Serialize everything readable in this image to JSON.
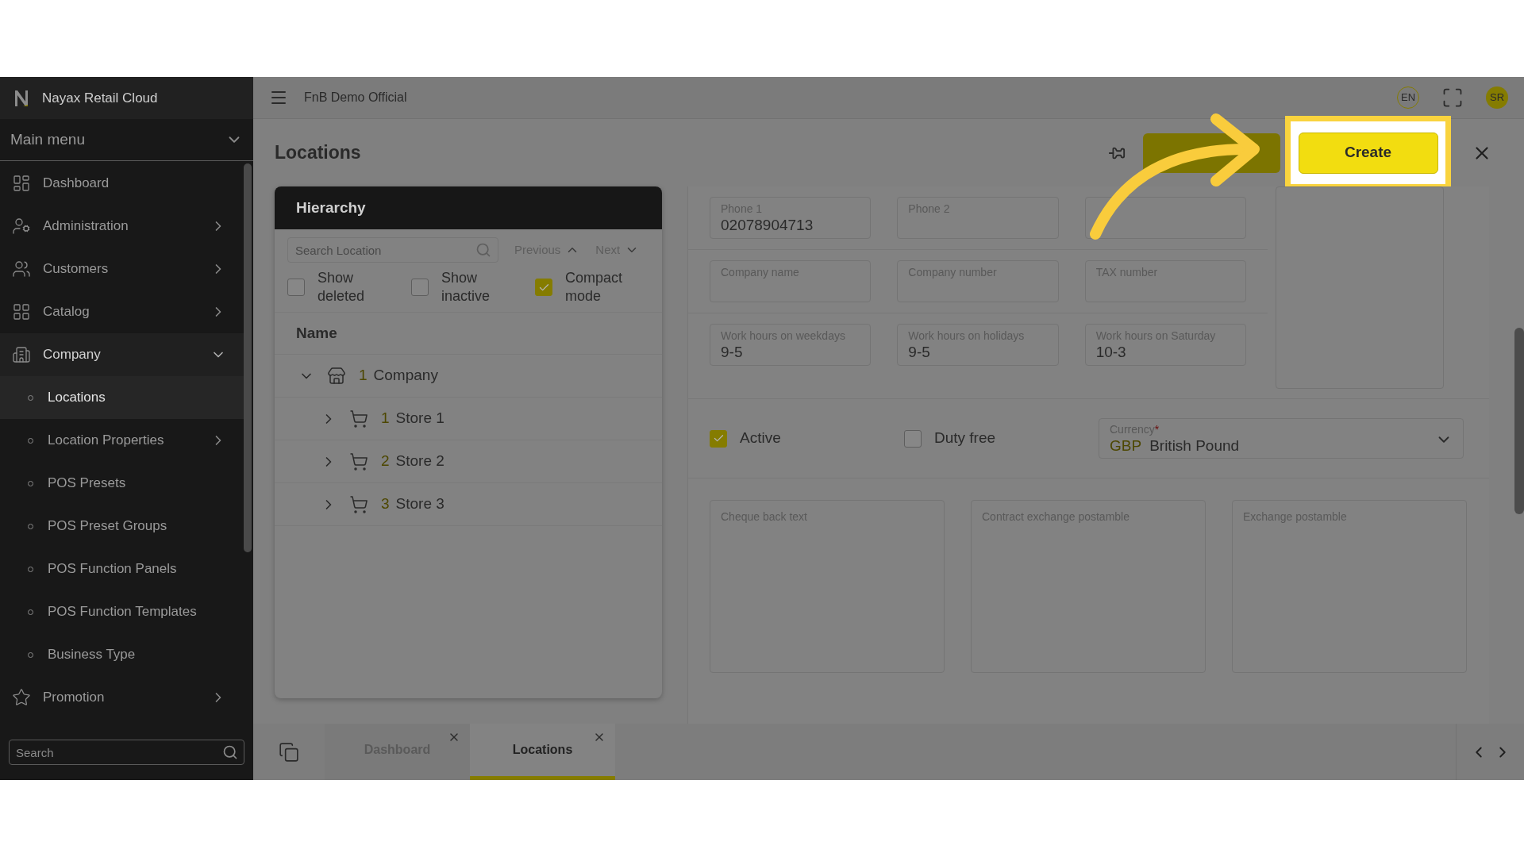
{
  "app": {
    "brand": "Nayax Retail Cloud",
    "company": "FnB Demo Official",
    "language": "EN",
    "avatar": "SR"
  },
  "sidebar": {
    "menu_title": "Main menu",
    "search_placeholder": "Search",
    "items": [
      {
        "label": "Dashboard",
        "has_submenu": false,
        "expanded": false,
        "selected": false
      },
      {
        "label": "Administration",
        "has_submenu": true,
        "expanded": false,
        "selected": false
      },
      {
        "label": "Customers",
        "has_submenu": true,
        "expanded": false,
        "selected": false
      },
      {
        "label": "Catalog",
        "has_submenu": true,
        "expanded": false,
        "selected": false
      },
      {
        "label": "Company",
        "has_submenu": true,
        "expanded": true,
        "selected": false,
        "children": [
          {
            "label": "Locations",
            "has_submenu": false,
            "selected": true
          },
          {
            "label": "Location Properties",
            "has_submenu": true,
            "selected": false
          },
          {
            "label": "POS Presets",
            "has_submenu": false,
            "selected": false
          },
          {
            "label": "POS Preset Groups",
            "has_submenu": false,
            "selected": false
          },
          {
            "label": "POS Function Panels",
            "has_submenu": false,
            "selected": false
          },
          {
            "label": "POS Function Templates",
            "has_submenu": false,
            "selected": false
          },
          {
            "label": "Business Type",
            "has_submenu": false,
            "selected": false
          }
        ]
      },
      {
        "label": "Promotion",
        "has_submenu": true,
        "expanded": false,
        "selected": false
      }
    ]
  },
  "page": {
    "title": "Locations",
    "create_button": "Create"
  },
  "hierarchy": {
    "title": "Hierarchy",
    "search_placeholder": "Search Location",
    "previous": "Previous",
    "next": "Next",
    "filters": [
      {
        "label": "Show deleted",
        "checked": false
      },
      {
        "label": "Show inactive",
        "checked": false
      },
      {
        "label": "Compact mode",
        "checked": true
      }
    ],
    "column": "Name",
    "tree": [
      {
        "kind": "company",
        "number": "1",
        "name": "Company",
        "expanded": true,
        "children": [
          {
            "kind": "store",
            "number": "1",
            "name": "Store 1",
            "expanded": false
          },
          {
            "kind": "store",
            "number": "2",
            "name": "Store 2",
            "expanded": false
          },
          {
            "kind": "store",
            "number": "3",
            "name": "Store 3",
            "expanded": false
          }
        ]
      }
    ]
  },
  "form": {
    "field_rows": [
      [
        {
          "kind": "labelled",
          "label": "Phone 1",
          "value": "02078904713"
        },
        {
          "kind": "labelled",
          "label": "Phone 2"
        },
        {
          "kind": "blank"
        }
      ],
      [
        {
          "kind": "labelled",
          "label": "Company name"
        },
        {
          "kind": "labelled",
          "label": "Company number"
        },
        {
          "kind": "labelled",
          "label": "TAX number"
        }
      ],
      [
        {
          "kind": "labelled",
          "label": "Work hours on weekdays",
          "value": "9-5"
        },
        {
          "kind": "labelled",
          "label": "Work hours on holidays",
          "value": "9-5"
        },
        {
          "kind": "labelled",
          "label": "Work hours on Saturday",
          "value": "10-3"
        }
      ]
    ],
    "checkboxes": [
      {
        "label": "Active",
        "checked": true
      },
      {
        "label": "Duty free",
        "checked": false
      }
    ],
    "currency": {
      "label": "Currency",
      "required_mark": "*",
      "code": "GBP",
      "value": "British Pound"
    },
    "text_areas": [
      {
        "label": "Cheque back text"
      },
      {
        "label": "Contract exchange postamble"
      },
      {
        "label": "Exchange postamble"
      }
    ]
  },
  "tabs": [
    {
      "label": "Dashboard",
      "selected": false
    },
    {
      "label": "Locations",
      "selected": true
    }
  ]
}
